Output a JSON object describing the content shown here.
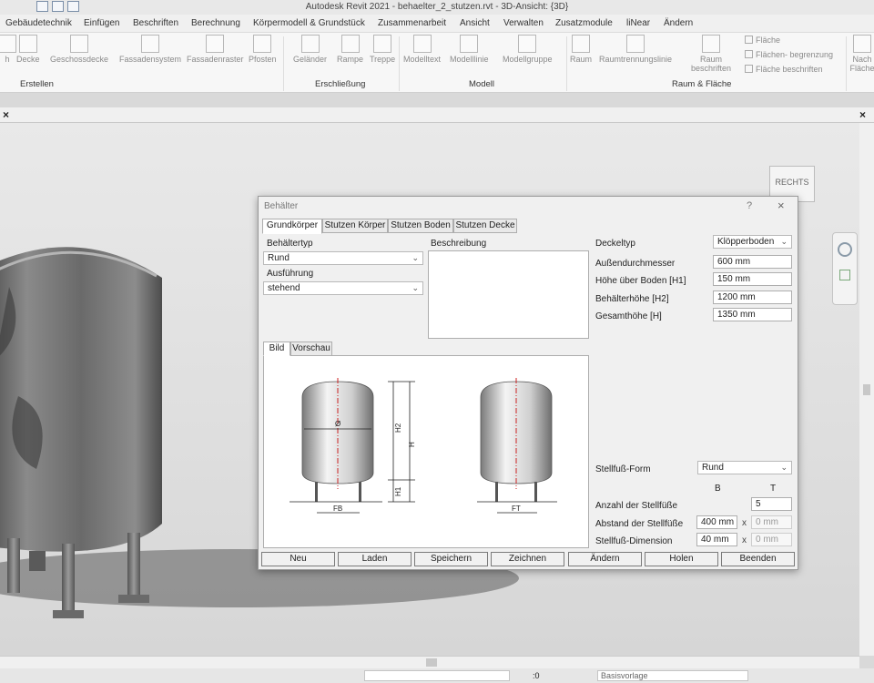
{
  "window": {
    "title": "Autodesk Revit 2021 - behaelter_2_stutzen.rvt - 3D-Ansicht: {3D}"
  },
  "menu": {
    "tabs": [
      "Gebäudetechnik",
      "Einfügen",
      "Beschriften",
      "Berechnung",
      "Körpermodell & Grundstück",
      "Zusammenarbeit",
      "Ansicht",
      "Verwalten",
      "Zusatzmodule",
      "liNear",
      "Ändern"
    ]
  },
  "ribbon": {
    "buttons": [
      "h",
      "Decke",
      "Geschossdecke",
      "Fassadensystem",
      "Fassadenraster",
      "Pfosten",
      "Geländer",
      "Rampe",
      "Treppe",
      "Modelltext",
      "Modelllinie",
      "Modellgruppe",
      "Raum",
      "Raumtrennungslinie",
      "Raum beschriften",
      "Nach Fläche"
    ],
    "small": [
      "Fläche",
      "Flächen- begrenzung",
      "Fläche beschriften"
    ],
    "groups": [
      "Erstellen",
      "Erschließung",
      "Modell",
      "Raum & Fläche"
    ]
  },
  "viewport": {
    "close_glyph": "×",
    "viewcube_label": "RECHTS"
  },
  "dialog": {
    "title": "Behälter",
    "help": "?",
    "close": "×",
    "tabs": [
      "Grundkörper",
      "Stutzen Körper",
      "Stutzen Boden",
      "Stutzen Decke"
    ],
    "behaeltertyp_label": "Behältertyp",
    "behaeltertyp_value": "Rund",
    "ausfuehrung_label": "Ausführung",
    "ausfuehrung_value": "stehend",
    "beschreibung_label": "Beschreibung",
    "deckeltyp_label": "Deckeltyp",
    "deckeltyp_value": "Klöpperboden",
    "aussendurchmesser_label": "Außendurchmesser",
    "aussendurchmesser_value": "600 mm",
    "hoehe_boden_label": "Höhe über Boden [H1]",
    "hoehe_boden_value": "150 mm",
    "behaelterhoehe_label": "Behälterhöhe [H2]",
    "behaelterhoehe_value": "1200 mm",
    "gesamthoehe_label": "Gesamthöhe [H]",
    "gesamthoehe_value": "1350 mm",
    "preview_tabs": [
      "Bild",
      "Vorschau"
    ],
    "drawing_labels": {
      "h2": "H2",
      "h": "H",
      "h1": "H1",
      "fb": "FB",
      "ft": "FT",
      "d": "Ø"
    },
    "stellfuss_form_label": "Stellfuß-Form",
    "stellfuss_form_value": "Rund",
    "col_b": "B",
    "col_t": "T",
    "anzahl_label": "Anzahl der Stellfüße",
    "anzahl_value": "5",
    "abstand_label": "Abstand der Stellfüße",
    "abstand_b": "400 mm",
    "abstand_t": "0 mm",
    "dimension_label": "Stellfuß-Dimension",
    "dimension_b": "40 mm",
    "dimension_t": "0 mm",
    "x_sep": "x",
    "buttons": [
      "Neu",
      "Laden",
      "Speichern",
      "Zeichnen",
      "Ändern",
      "Holen",
      "Beenden"
    ]
  },
  "status": {
    "count": ":0",
    "template": "Basisvorlage"
  }
}
